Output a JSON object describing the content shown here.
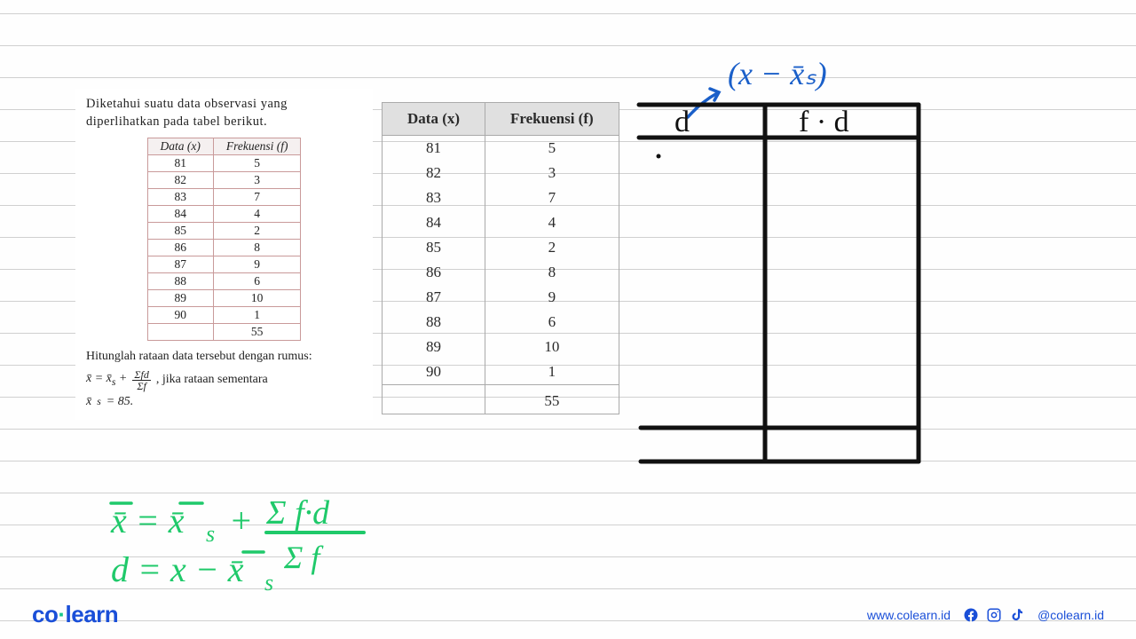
{
  "problem": {
    "intro_text": "Diketahui suatu data observasi yang diperlihatkan pada tabel berikut.",
    "small_table": {
      "headers": {
        "data": "Data (x)",
        "freq": "Frekuensi (f)"
      },
      "rows": [
        {
          "x": "81",
          "f": "5"
        },
        {
          "x": "82",
          "f": "3"
        },
        {
          "x": "83",
          "f": "7"
        },
        {
          "x": "84",
          "f": "4"
        },
        {
          "x": "85",
          "f": "2"
        },
        {
          "x": "86",
          "f": "8"
        },
        {
          "x": "87",
          "f": "9"
        },
        {
          "x": "88",
          "f": "6"
        },
        {
          "x": "89",
          "f": "10"
        },
        {
          "x": "90",
          "f": "1"
        }
      ],
      "sum": "55"
    },
    "question_text": "Hitunglah rataan data tersebut dengan rumus:",
    "formula_prefix": "x̄ = x̄ₛ +",
    "formula_frac_num": "Σfd",
    "formula_frac_den": "Σf",
    "formula_suffix": ", jika rataan sementara",
    "formula_line2": "x̄ₛ = 85."
  },
  "big_table": {
    "headers": {
      "data": "Data (x)",
      "freq": "Frekuensi (f)"
    },
    "rows": [
      {
        "x": "81",
        "f": "5"
      },
      {
        "x": "82",
        "f": "3"
      },
      {
        "x": "83",
        "f": "7"
      },
      {
        "x": "84",
        "f": "4"
      },
      {
        "x": "85",
        "f": "2"
      },
      {
        "x": "86",
        "f": "8"
      },
      {
        "x": "87",
        "f": "9"
      },
      {
        "x": "88",
        "f": "6"
      },
      {
        "x": "89",
        "f": "10"
      },
      {
        "x": "90",
        "f": "1"
      }
    ],
    "sum": "55"
  },
  "handwritten": {
    "blue_annotation": "(x − x̄ₛ)",
    "black_col1": "d",
    "black_col2": "f · d",
    "green_line1": "x̄ = x̄ₛ + Σ f·d",
    "green_line1b": "Σ f",
    "green_line2": "d = x − x̄ₛ"
  },
  "footer": {
    "logo_co": "co",
    "logo_learn": "learn",
    "website": "www.colearn.id",
    "handle": "@colearn.id"
  },
  "colors": {
    "blue_ink": "#1a5fc9",
    "black_ink": "#111",
    "green_ink": "#1fc96a",
    "brand_blue": "#1a4fd8"
  }
}
